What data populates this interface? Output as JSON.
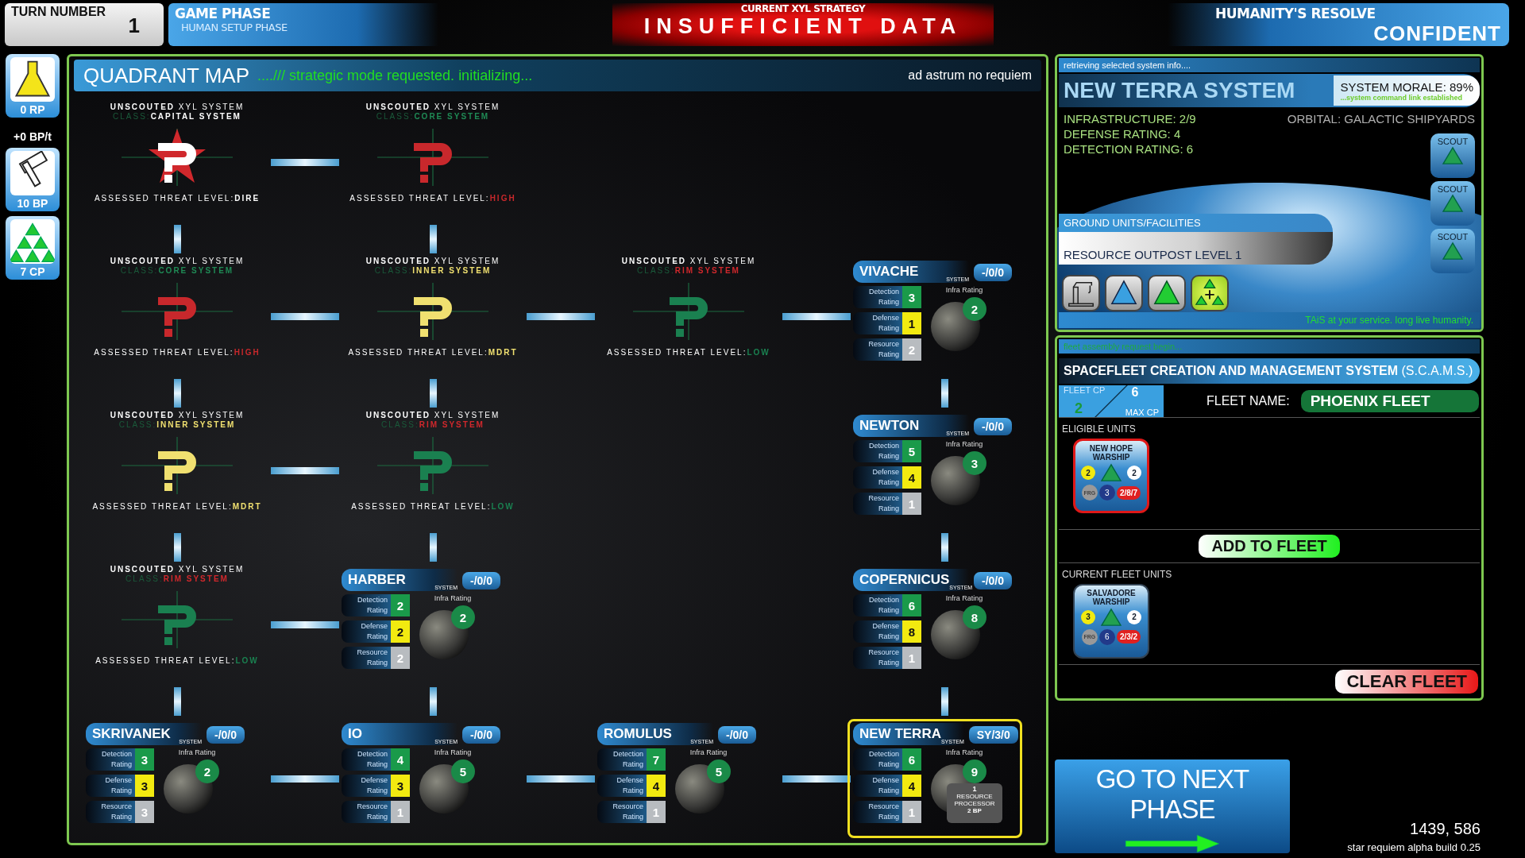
{
  "top_bar": {
    "turn": {
      "label": "TURN NUMBER",
      "value": "1"
    },
    "phase": {
      "label": "GAME PHASE",
      "value": "HUMAN SETUP PHASE"
    },
    "strategy": {
      "label": "CURRENT XYL STRATEGY",
      "value": "INSUFFICIENT DATA"
    },
    "resolve": {
      "label": "HUMANITY'S RESOLVE",
      "value": "CONFIDENT"
    }
  },
  "resources": [
    {
      "kind": "research",
      "value": "0 RP"
    },
    {
      "kind": "build",
      "rate": "+0 BP/t",
      "value": "10 BP"
    },
    {
      "kind": "command",
      "value": "7 CP"
    }
  ],
  "quadrant_map": {
    "title": "QUADRANT MAP",
    "status": "..../// strategic mode requested. initializing...",
    "motto": "ad astrum no requiem",
    "rows": [
      [
        {
          "kind": "unscouted",
          "title": "**UNSCOUTED** XYL SYSTEM",
          "class_label": "CLASS:",
          "class": {
            "text": "CAPITAL  SYSTEM",
            "color": "#ffffff"
          },
          "capital": true,
          "color": "#ffffff",
          "threat_label": "ASSESSED THREAT LEVEL:",
          "threat": "DIRE",
          "link_right": true,
          "link_down": true
        },
        {
          "kind": "unscouted",
          "title": "**UNSCOUTED** XYL SYSTEM",
          "class_label": "CLASS:",
          "class": {
            "text": "CORE SYSTEM",
            "color": "#1f8a55"
          },
          "capital": false,
          "color": "#c8282c",
          "threat_label": "ASSESSED THREAT LEVEL:",
          "threat": "HIGH",
          "link_right": false,
          "link_down": true
        },
        {
          "kind": "empty"
        },
        {
          "kind": "empty"
        }
      ],
      [
        {
          "kind": "unscouted",
          "title": "**UNSCOUTED** XYL SYSTEM",
          "class_label": "CLASS:",
          "class": {
            "text": "CORE SYSTEM",
            "color": "#1f8a55"
          },
          "capital": false,
          "color": "#c8282c",
          "threat_label": "ASSESSED THREAT LEVEL:",
          "threat": "HIGH",
          "link_right": true,
          "link_down": true
        },
        {
          "kind": "unscouted",
          "title": "**UNSCOUTED** XYL SYSTEM",
          "class_label": "CLASS:",
          "class": {
            "text": "INNER SYSTEM",
            "color": "#f0e070"
          },
          "capital": false,
          "color": "#f0e070",
          "threat_label": "ASSESSED THREAT LEVEL:",
          "threat": "MDRT",
          "link_right": true,
          "link_down": true
        },
        {
          "kind": "unscouted",
          "title": "**UNSCOUTED** XYL SYSTEM",
          "class_label": "CLASS:",
          "class": {
            "text": "RIM SYSTEM",
            "color": "#d0282c"
          },
          "capital": false,
          "color": "#1a8050",
          "threat_label": "ASSESSED THREAT LEVEL:",
          "threat": "LOW",
          "link_right": true,
          "link_down": false
        },
        {
          "kind": "system",
          "name": "VIVACHE",
          "system_label": "SYSTEM",
          "badge": "-/0/0",
          "selected": false,
          "infra_label": "Infra Rating",
          "infra": "2",
          "link_right": false,
          "link_down": true,
          "ratings": [
            {
              "kind": "detection",
              "label": "Detection Rating",
              "value": "3"
            },
            {
              "kind": "defense",
              "label": "Defense Rating",
              "value": "1"
            },
            {
              "kind": "resource",
              "label": "Resource Rating",
              "value": "2"
            }
          ]
        }
      ],
      [
        {
          "kind": "unscouted",
          "title": "**UNSCOUTED** XYL SYSTEM",
          "class_label": "CLASS:",
          "class": {
            "text": "INNER SYSTEM",
            "color": "#f0e070"
          },
          "capital": false,
          "color": "#f0e070",
          "threat_label": "ASSESSED THREAT LEVEL:",
          "threat": "MDRT",
          "link_right": true,
          "link_down": true
        },
        {
          "kind": "unscouted",
          "title": "**UNSCOUTED** XYL SYSTEM",
          "class_label": "CLASS:",
          "class": {
            "text": "RIM SYSTEM",
            "color": "#d0282c"
          },
          "capital": false,
          "color": "#1a8050",
          "threat_label": "ASSESSED THREAT LEVEL:",
          "threat": "LOW",
          "link_right": false,
          "link_down": true
        },
        {
          "kind": "empty"
        },
        {
          "kind": "system",
          "name": "NEWTON",
          "system_label": "SYSTEM",
          "badge": "-/0/0",
          "selected": false,
          "infra_label": "Infra Rating",
          "infra": "3",
          "link_right": false,
          "link_down": true,
          "ratings": [
            {
              "kind": "detection",
              "label": "Detection Rating",
              "value": "5"
            },
            {
              "kind": "defense",
              "label": "Defense Rating",
              "value": "4"
            },
            {
              "kind": "resource",
              "label": "Resource Rating",
              "value": "1"
            }
          ]
        }
      ],
      [
        {
          "kind": "unscouted",
          "title": "**UNSCOUTED** XYL SYSTEM",
          "class_label": "CLASS:",
          "class": {
            "text": "RIM SYSTEM",
            "color": "#d0282c"
          },
          "capital": false,
          "color": "#1a8050",
          "threat_label": "ASSESSED THREAT LEVEL:",
          "threat": "LOW",
          "link_right": true,
          "link_down": true
        },
        {
          "kind": "system",
          "name": "HARBER",
          "system_label": "SYSTEM",
          "badge": "-/0/0",
          "selected": false,
          "infra_label": "Infra Rating",
          "infra": "2",
          "link_right": false,
          "link_down": true,
          "ratings": [
            {
              "kind": "detection",
              "label": "Detection Rating",
              "value": "2"
            },
            {
              "kind": "defense",
              "label": "Defense Rating",
              "value": "2"
            },
            {
              "kind": "resource",
              "label": "Resource Rating",
              "value": "2"
            }
          ]
        },
        {
          "kind": "empty"
        },
        {
          "kind": "system",
          "name": "COPERNICUS",
          "system_label": "SYSTEM",
          "badge": "-/0/0",
          "selected": false,
          "infra_label": "Infra Rating",
          "infra": "8",
          "link_right": false,
          "link_down": true,
          "ratings": [
            {
              "kind": "detection",
              "label": "Detection Rating",
              "value": "6"
            },
            {
              "kind": "defense",
              "label": "Defense Rating",
              "value": "8"
            },
            {
              "kind": "resource",
              "label": "Resource Rating",
              "value": "1"
            }
          ]
        }
      ],
      [
        {
          "kind": "system",
          "name": "SKRIVANEK",
          "system_label": "SYSTEM",
          "badge": "-/0/0",
          "selected": false,
          "infra_label": "Infra Rating",
          "infra": "2",
          "link_right": true,
          "link_down": false,
          "ratings": [
            {
              "kind": "detection",
              "label": "Detection Rating",
              "value": "3"
            },
            {
              "kind": "defense",
              "label": "Defense Rating",
              "value": "3"
            },
            {
              "kind": "resource",
              "label": "Resource Rating",
              "value": "3"
            }
          ]
        },
        {
          "kind": "system",
          "name": "IO",
          "system_label": "SYSTEM",
          "badge": "-/0/0",
          "selected": false,
          "infra_label": "Infra Rating",
          "infra": "5",
          "link_right": true,
          "link_down": false,
          "ratings": [
            {
              "kind": "detection",
              "label": "Detection Rating",
              "value": "4"
            },
            {
              "kind": "defense",
              "label": "Defense Rating",
              "value": "3"
            },
            {
              "kind": "resource",
              "label": "Resource Rating",
              "value": "1"
            }
          ]
        },
        {
          "kind": "system",
          "name": "ROMULUS",
          "system_label": "SYSTEM",
          "badge": "-/0/0",
          "selected": false,
          "infra_label": "Infra Rating",
          "infra": "5",
          "link_right": true,
          "link_down": false,
          "ratings": [
            {
              "kind": "detection",
              "label": "Detection Rating",
              "value": "7"
            },
            {
              "kind": "defense",
              "label": "Defense Rating",
              "value": "4"
            },
            {
              "kind": "resource",
              "label": "Resource Rating",
              "value": "1"
            }
          ]
        },
        {
          "kind": "system",
          "name": "NEW TERRA",
          "system_label": "SYSTEM",
          "badge": "SY/3/0",
          "selected": true,
          "infra_label": "Infra Rating",
          "infra": "9",
          "link_right": false,
          "link_down": false,
          "facility": {
            "count": "1",
            "name": "RESOURCE PROCESSOR",
            "cost": "2 BP"
          },
          "ratings": [
            {
              "kind": "detection",
              "label": "Detection Rating",
              "value": "6"
            },
            {
              "kind": "defense",
              "label": "Defense Rating",
              "value": "4"
            },
            {
              "kind": "resource",
              "label": "Resource Rating",
              "value": "1"
            }
          ]
        }
      ]
    ]
  },
  "system_info": {
    "status": "retrieving selected system info....",
    "title": "NEW TERRA SYSTEM",
    "morale": "SYSTEM MORALE: 89%",
    "link": "...system command link established",
    "stats": [
      "INFRASTRUCTURE: 2/9",
      "DEFENSE RATING: 4",
      "DETECTION RATING: 6"
    ],
    "orbital": "ORBITAL: GALACTIC SHIPYARDS",
    "scouts": [
      "SCOUT",
      "SCOUT",
      "SCOUT"
    ],
    "ground_header": "GROUND UNITS/FACILITIES",
    "ground_unit": "RESOURCE OUTPOST LEVEL 1",
    "build_options": [
      {
        "kind": "crane"
      },
      {
        "kind": "blue_triangle"
      },
      {
        "kind": "green_triangle"
      },
      {
        "kind": "triple_triangle"
      }
    ],
    "footer": "TAiS at your service. long live humanity."
  },
  "fleet": {
    "status": "fleet assembly request begin...",
    "title": "**SPACEFLEET CREATION AND MANAGEMENT SYSTEM** (S.C.A.M.S.)",
    "cp_label": "FLEET CP",
    "cp": "2",
    "max_cp": "6",
    "max_label": "MAX CP",
    "name_label": "FLEET NAME:",
    "name": "PHOENIX FLEET",
    "eligible_label": "ELIGIBLE UNITS",
    "eligible": [
      {
        "name": "NEW HOPE",
        "type": "WARSHIP",
        "attack": "2",
        "hull": "2",
        "class": "FRG",
        "cost": "3",
        "stats": "2/8/7",
        "selected": true
      }
    ],
    "add_button": "ADD TO FLEET",
    "current_label": "CURRENT FLEET UNITS",
    "current": [
      {
        "name": "SALVADORE",
        "type": "WARSHIP",
        "attack": "3",
        "hull": "2",
        "class": "FRG",
        "cost": "6",
        "stats": "2/3/2",
        "selected": false
      }
    ],
    "clear_button": "CLEAR FLEET"
  },
  "next_phase": "GO TO NEXT PHASE",
  "coordinates": "1439, 586",
  "build": "star requiem alpha build 0.25"
}
